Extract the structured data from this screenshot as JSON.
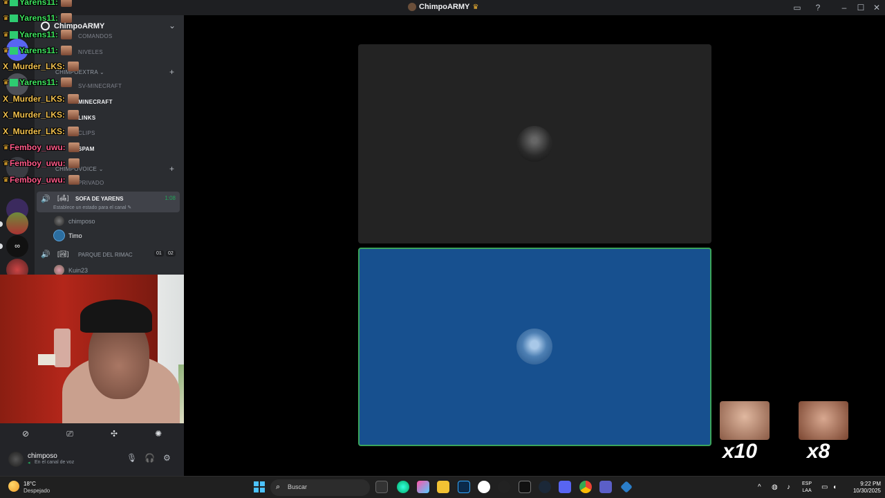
{
  "window": {
    "title": "ChimpoARMY"
  },
  "server": {
    "name": "ChimpoARMY"
  },
  "channels": {
    "text": [
      {
        "label": "comandos"
      },
      {
        "label": "niveles"
      },
      {
        "label": "sv-minecraft"
      },
      {
        "label": "minecraft"
      },
      {
        "label": "links"
      },
      {
        "label": "clips"
      },
      {
        "label": "spam"
      }
    ],
    "categories": [
      {
        "label": "CHIMPOEXTRA"
      },
      {
        "label": "CHIMPOVOICE"
      }
    ],
    "private_label": "privado"
  },
  "voice_channels": [
    {
      "name": "SOFA DE YARENS",
      "tag": "[🛋]",
      "status_placeholder": "Establece un estado para el canal",
      "elapsed": "1:08",
      "members": [
        "chimposo",
        "Timo"
      ]
    },
    {
      "name": "PARQUE DEL RIMAC",
      "tag": "[🏞]",
      "count_a": "01",
      "count_b": "02",
      "members": [
        "Kuin23"
      ]
    }
  ],
  "chat": [
    {
      "user": "Yarens11:",
      "color": "#3ee35e"
    },
    {
      "user": "Yarens11:",
      "color": "#3ee35e"
    },
    {
      "user": "Yarens11:",
      "color": "#3ee35e"
    },
    {
      "user": "X_Murder_LKS:",
      "color": "#f2c14e"
    },
    {
      "user": "Yarens11:",
      "color": "#3ee35e"
    },
    {
      "user": "X_Murder_LKS:",
      "color": "#f2c14e"
    },
    {
      "user": "X_Murder_LKS:",
      "color": "#f2c14e"
    },
    {
      "user": "X_Murder_LKS:",
      "color": "#f2c14e"
    },
    {
      "user": "Femboy_uwu:",
      "color": "#ff5b8a"
    },
    {
      "user": "Femboy_uwu:",
      "color": "#ff5b8a"
    },
    {
      "user": "Femboy_uwu:",
      "color": "#ff5b8a"
    }
  ],
  "user_panel": {
    "username": "chimposo",
    "status": "En el canal de voz"
  },
  "reactions": [
    {
      "count": "x10"
    },
    {
      "count": "x8"
    }
  ],
  "taskbar": {
    "weather_temp": "18°C",
    "weather_cond": "Despejado",
    "search_placeholder": "Buscar",
    "lang_1": "ESP",
    "lang_2": "LAA",
    "time": "9:22 PM",
    "date": "10/30/2025"
  },
  "icons": {
    "start": "windows-start-icon",
    "search": "search-icon",
    "mic": "microphone-icon",
    "headset": "headset-icon",
    "settings": "gear-icon"
  },
  "colors": {
    "speaking_border": "#3ba55c",
    "tile_blue": "#17508f",
    "sidebar_bg": "#2b2d31"
  }
}
